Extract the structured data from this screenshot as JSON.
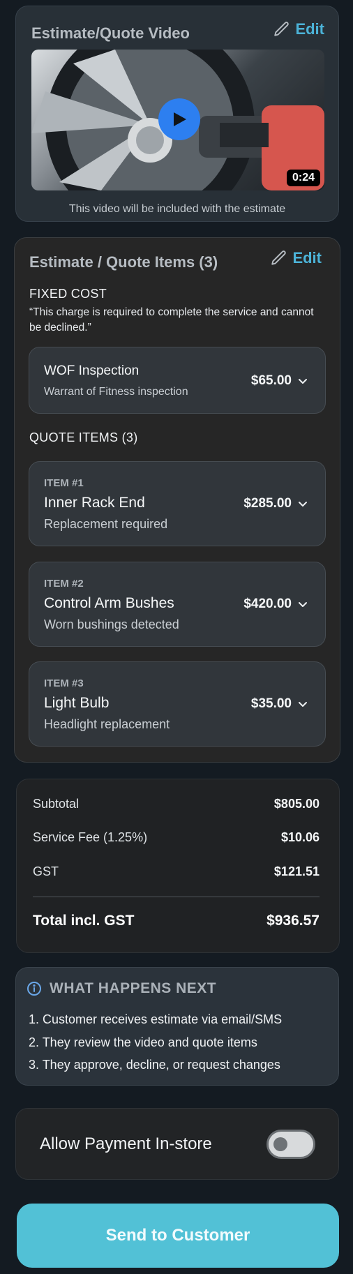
{
  "video_section": {
    "title": "Estimate/Quote Video",
    "edit_label": "Edit",
    "duration": "0:24",
    "caption": "This video will be included with the estimate"
  },
  "items_section": {
    "title": "Estimate / Quote Items (3)",
    "edit_label": "Edit",
    "fixed_cost_label": "FIXED COST",
    "fixed_cost_note": "“This charge is required to complete the service and cannot be declined.”",
    "fixed_item": {
      "title": "WOF Inspection",
      "subtitle": "Warrant of Fitness inspection",
      "price": "$65.00"
    },
    "quote_items_label": "QUOTE ITEMS (3)",
    "items": [
      {
        "number": "ITEM #1",
        "title": "Inner Rack End",
        "subtitle": "Replacement required",
        "price": "$285.00"
      },
      {
        "number": "ITEM #2",
        "title": "Control Arm Bushes",
        "subtitle": "Worn bushings detected",
        "price": "$420.00"
      },
      {
        "number": "ITEM #3",
        "title": "Light Bulb",
        "subtitle": "Headlight replacement",
        "price": "$35.00"
      }
    ]
  },
  "totals": {
    "subtotal_label": "Subtotal",
    "subtotal_value": "$805.00",
    "service_fee_label": "Service Fee (1.25%)",
    "service_fee_value": "$10.06",
    "gst_label": "GST",
    "gst_value": "$121.51",
    "total_label": "Total incl. GST",
    "total_value": "$936.57"
  },
  "next_steps": {
    "title": "WHAT HAPPENS NEXT",
    "steps": [
      "1. Customer receives estimate via email/SMS",
      "2. They review the video and quote items",
      "3. They approve, decline, or request changes"
    ]
  },
  "payment": {
    "label": "Allow Payment In-store",
    "enabled": false
  },
  "send_button_label": "Send to Customer",
  "colors": {
    "accent": "#4cb3d8",
    "send_button": "#52c1d6",
    "play_button": "#2d7ff0"
  },
  "icons": [
    "pencil-icon",
    "play-icon",
    "chevron-down-icon",
    "info-icon"
  ]
}
